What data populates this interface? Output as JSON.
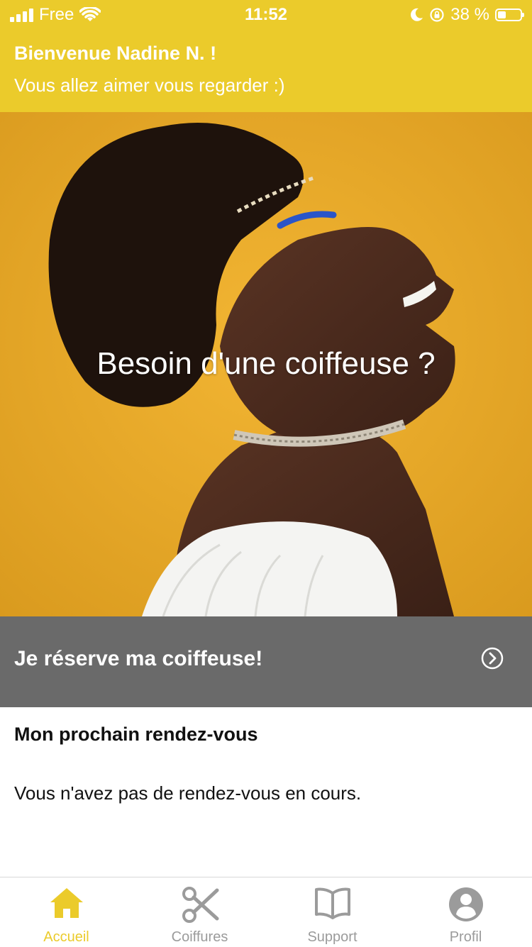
{
  "status_bar": {
    "carrier": "Free",
    "time": "11:52",
    "battery_percent": "38 %",
    "battery_level": 0.38,
    "icons": [
      "signal-icon",
      "wifi-icon",
      "moon-icon",
      "orientation-lock-icon",
      "battery-icon"
    ]
  },
  "header": {
    "welcome": "Bienvenue Nadine N. !",
    "tagline": "Vous allez aimer vous regarder :)"
  },
  "hero": {
    "title": "Besoin d'une coiffeuse ?"
  },
  "cta": {
    "label": "Je réserve ma coiffeuse!",
    "icon": "chevron-right-circle-icon"
  },
  "appointment": {
    "title": "Mon prochain rendez-vous",
    "empty_message": "Vous n'avez pas de rendez-vous en cours."
  },
  "tabs": [
    {
      "label": "Accueil",
      "icon": "home-icon",
      "active": true
    },
    {
      "label": "Coiffures",
      "icon": "scissors-icon",
      "active": false
    },
    {
      "label": "Support",
      "icon": "book-icon",
      "active": false
    },
    {
      "label": "Profil",
      "icon": "user-icon",
      "active": false
    }
  ],
  "colors": {
    "brand_yellow": "#EBCB2B",
    "cta_gray": "#6A6A6A",
    "tab_inactive": "#9B9B9B"
  }
}
